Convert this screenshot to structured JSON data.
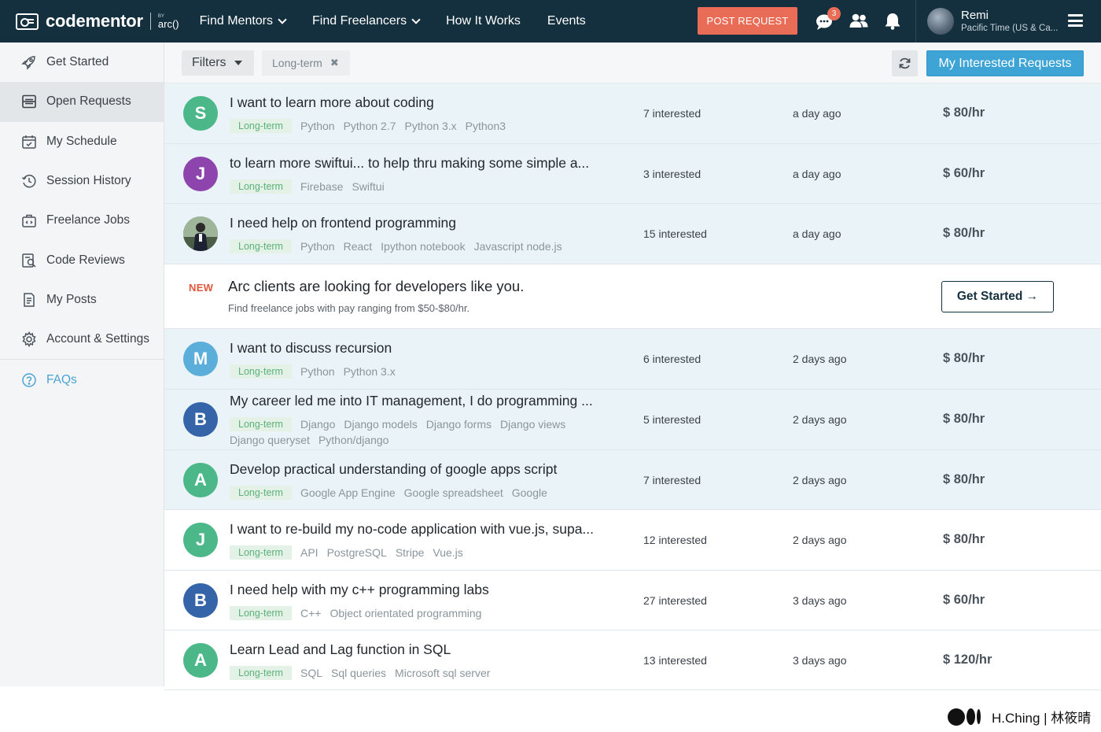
{
  "brand": {
    "name": "codementor",
    "by": "BY",
    "partner": "arc()"
  },
  "nav": {
    "items": [
      {
        "label": "Find Mentors",
        "dropdown": true
      },
      {
        "label": "Find Freelancers",
        "dropdown": true
      },
      {
        "label": "How It Works",
        "dropdown": false
      },
      {
        "label": "Events",
        "dropdown": false
      }
    ],
    "post_request": "POST REQUEST",
    "messages_badge": "3",
    "user": {
      "name": "Remi",
      "timezone": "Pacific Time (US & Ca..."
    }
  },
  "sidebar": {
    "items": [
      {
        "label": "Get Started",
        "icon": "rocket-icon"
      },
      {
        "label": "Open Requests",
        "icon": "list-icon",
        "active": true
      },
      {
        "label": "My Schedule",
        "icon": "calendar-icon"
      },
      {
        "label": "Session History",
        "icon": "history-icon"
      },
      {
        "label": "Freelance Jobs",
        "icon": "briefcase-icon"
      },
      {
        "label": "Code Reviews",
        "icon": "code-review-icon"
      },
      {
        "label": "My Posts",
        "icon": "document-icon"
      },
      {
        "label": "Account & Settings",
        "icon": "gear-icon"
      }
    ],
    "faq": "FAQs"
  },
  "filterbar": {
    "filters_label": "Filters",
    "active_filter": "Long-term",
    "my_interested": "My Interested Requests"
  },
  "requests": [
    {
      "initial": "S",
      "avatar_color": "#4cb88a",
      "title": "I want to learn more about coding",
      "longterm": "Long-term",
      "tags": [
        "Python",
        "Python 2.7",
        "Python 3.x",
        "Python3"
      ],
      "interested": "7 interested",
      "when": "a day ago",
      "rate": "$ 80/hr",
      "highlight": true
    },
    {
      "initial": "J",
      "avatar_color": "#8e44ad",
      "title": "to learn more swiftui... to help thru making some simple a...",
      "longterm": "Long-term",
      "tags": [
        "Firebase",
        "Swiftui"
      ],
      "interested": "3 interested",
      "when": "a day ago",
      "rate": "$ 60/hr",
      "highlight": true
    },
    {
      "initial": "",
      "avatar_color": "",
      "photo": true,
      "title": "I need help on frontend programming",
      "longterm": "Long-term",
      "tags": [
        "Python",
        "React",
        "Ipython notebook",
        "Javascript node.js"
      ],
      "interested": "15 interested",
      "when": "a day ago",
      "rate": "$ 80/hr",
      "highlight": true
    },
    {
      "initial": "M",
      "avatar_color": "#5aaed9",
      "title": "I want to discuss recursion",
      "longterm": "Long-term",
      "tags": [
        "Python",
        "Python 3.x"
      ],
      "interested": "6 interested",
      "when": "2 days ago",
      "rate": "$ 80/hr",
      "highlight": true
    },
    {
      "initial": "B",
      "avatar_color": "#3565a8",
      "title": "My career led me into IT management, I do programming ...",
      "longterm": "Long-term",
      "tags": [
        "Django",
        "Django models",
        "Django forms",
        "Django views",
        "Django queryset",
        "Python/django"
      ],
      "interested": "5 interested",
      "when": "2 days ago",
      "rate": "$ 80/hr",
      "highlight": true
    },
    {
      "initial": "A",
      "avatar_color": "#4cb88a",
      "title": "Develop practical understanding of google apps script",
      "longterm": "Long-term",
      "tags": [
        "Google App Engine",
        "Google spreadsheet",
        "Google"
      ],
      "interested": "7 interested",
      "when": "2 days ago",
      "rate": "$ 80/hr",
      "highlight": true
    },
    {
      "initial": "J",
      "avatar_color": "#4cb88a",
      "title": "I want to re-build my no-code application with vue.js, supa...",
      "longterm": "Long-term",
      "tags": [
        "API",
        "PostgreSQL",
        "Stripe",
        "Vue.js"
      ],
      "interested": "12 interested",
      "when": "2 days ago",
      "rate": "$ 80/hr",
      "highlight": false
    },
    {
      "initial": "B",
      "avatar_color": "#3565a8",
      "title": "I need help with my c++ programming labs",
      "longterm": "Long-term",
      "tags": [
        "C++",
        "Object orientated programming"
      ],
      "interested": "27 interested",
      "when": "3 days ago",
      "rate": "$ 60/hr",
      "highlight": false
    },
    {
      "initial": "A",
      "avatar_color": "#4cb88a",
      "title": "Learn Lead and Lag function in SQL",
      "longterm": "Long-term",
      "tags": [
        "SQL",
        "Sql queries",
        "Microsoft sql server"
      ],
      "interested": "13 interested",
      "when": "3 days ago",
      "rate": "$ 120/hr",
      "highlight": false
    }
  ],
  "promo": {
    "badge": "NEW",
    "title": "Arc clients are looking for developers like you.",
    "subtitle": "Find freelance jobs with pay ranging from $50-$80/hr.",
    "cta": "Get Started →"
  },
  "watermark": "H.Ching | 林筱晴"
}
